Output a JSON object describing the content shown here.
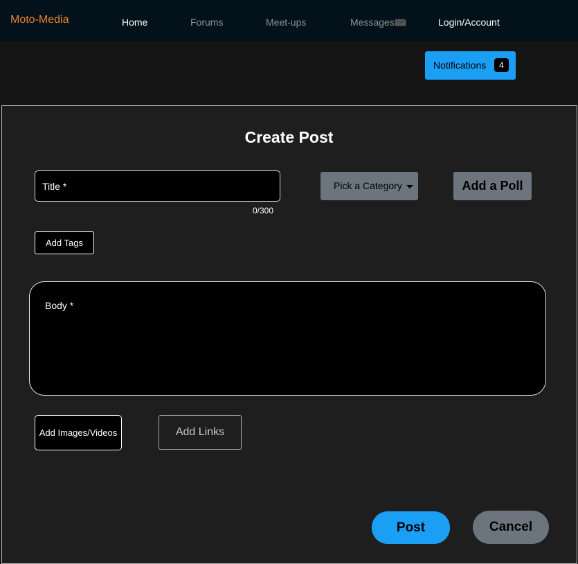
{
  "nav": {
    "brand": "Moto-Media",
    "home": "Home",
    "forums": "Forums",
    "meetups": "Meet-ups",
    "messages": "Messages",
    "account": "Login/Account"
  },
  "notifications": {
    "label": "Notifications",
    "count": "4"
  },
  "form": {
    "heading": "Create Post",
    "title_placeholder": "Title *",
    "title_counter": "0/300",
    "category_label": "Pick a Category",
    "poll_label": "Add a Poll",
    "tags_label": "Add Tags",
    "body_placeholder": "Body *",
    "media_label": "Add Images/Videos",
    "links_label": "Add Links",
    "post_label": "Post",
    "cancel_label": "Cancel"
  },
  "colors": {
    "brand": "#e8842a",
    "primary": "#1a9ff5",
    "secondary": "#6c757d",
    "navbar": "#03111a"
  }
}
